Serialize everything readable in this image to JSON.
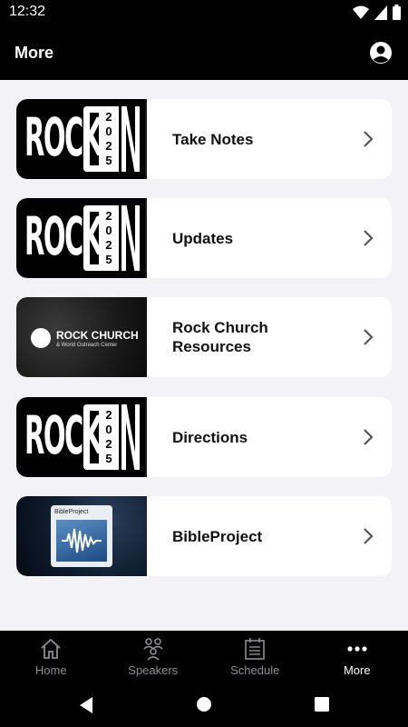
{
  "status_bar": {
    "time": "12:32"
  },
  "header": {
    "title": "More"
  },
  "items": [
    {
      "label": "Take Notes",
      "thumb": "rockcon",
      "year": "2025"
    },
    {
      "label": "Updates",
      "thumb": "rockcon",
      "year": "2025"
    },
    {
      "label": "Rock Church Resources",
      "thumb": "rockchurch",
      "church_name": "ROCK CHURCH",
      "church_sub": "& World Outreach Center"
    },
    {
      "label": "Directions",
      "thumb": "rockcon",
      "year": "2025"
    },
    {
      "label": "BibleProject",
      "thumb": "bibleproject",
      "bible_title": "BibleProject"
    }
  ],
  "rockcon_letters": "ROCK",
  "tabs": [
    {
      "label": "Home",
      "icon": "home-icon"
    },
    {
      "label": "Speakers",
      "icon": "speakers-icon"
    },
    {
      "label": "Schedule",
      "icon": "schedule-icon"
    },
    {
      "label": "More",
      "icon": "more-icon",
      "active": true
    }
  ]
}
